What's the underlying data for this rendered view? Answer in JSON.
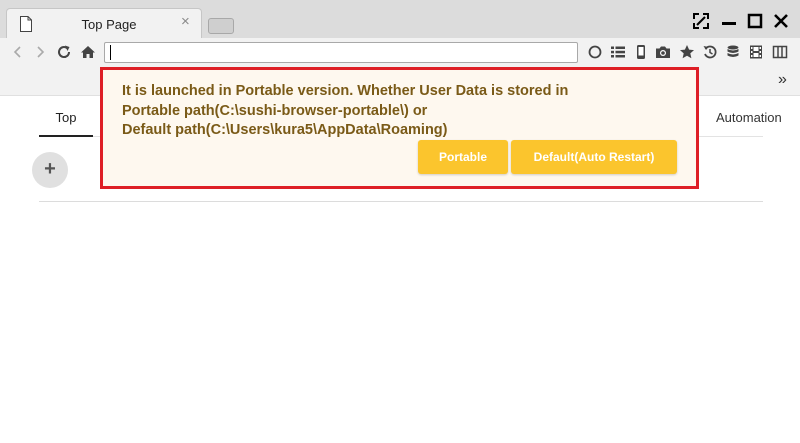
{
  "window": {
    "tab_title": "Top Page",
    "tab_close": "×"
  },
  "toolbar": {
    "address_value": "",
    "more_label": "»"
  },
  "content": {
    "tab_top": "Top",
    "tab_automation": "Automation",
    "add_label": "+"
  },
  "notification": {
    "line1": "It is launched in Portable version. Whether User Data is stored in",
    "line2": "Portable path(C:\\sushi-browser-portable\\) or",
    "line3": "Default path(C:\\Users\\kura5\\AppData\\Roaming)",
    "portable_button": "Portable",
    "default_button": "Default(Auto Restart)"
  },
  "colors": {
    "notice_border": "#de1f26",
    "notice_bg": "#fef8ef",
    "notice_text": "#7a5a17",
    "button_bg": "#fbc52d",
    "chrome_bg": "#dcdcdc"
  },
  "icons": {
    "tab": "document-icon",
    "window": [
      "fullscreen-icon",
      "minimize-icon",
      "maximize-icon",
      "close-icon"
    ],
    "nav": [
      "back-icon",
      "forward-icon",
      "reload-icon",
      "home-icon"
    ],
    "tools": [
      "circle-icon",
      "list-icon",
      "mobile-icon",
      "camera-icon",
      "star-icon",
      "history-icon",
      "database-icon",
      "film-icon",
      "columns-icon"
    ]
  }
}
